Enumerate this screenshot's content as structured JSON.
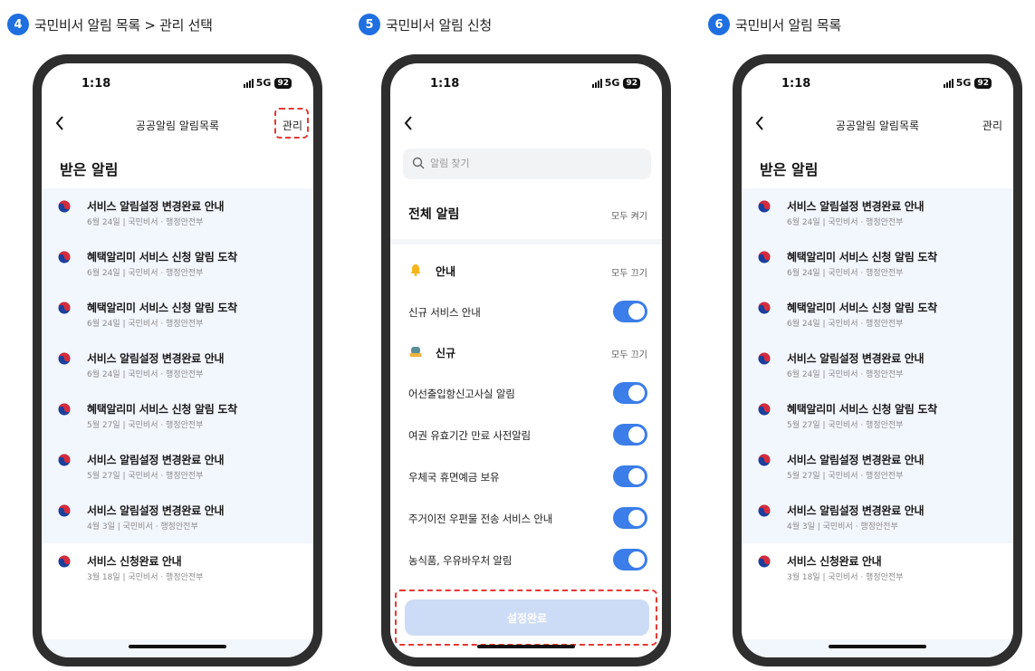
{
  "steps": [
    {
      "num": "4",
      "label": "국민비서 알림 목록 > 관리 선택"
    },
    {
      "num": "5",
      "label": "국민비서 알림 신청"
    },
    {
      "num": "6",
      "label": "국민비서 알림 목록"
    }
  ],
  "status": {
    "time": "1:18",
    "network": "5G",
    "battery": "92"
  },
  "list_screen": {
    "title": "공공알림 알림목록",
    "manage_label": "관리",
    "section_title": "받은 알림",
    "items": [
      {
        "title": "서비스 알림설정 변경완료 안내",
        "meta": "6월 24일 | 국민비서 · 행정안전부",
        "highlight": true
      },
      {
        "title": "혜택알리미 서비스 신청 알림 도착",
        "meta": "6월 24일 | 국민비서 · 행정안전부",
        "highlight": true
      },
      {
        "title": "혜택알리미 서비스 신청 알림 도착",
        "meta": "6월 24일 | 국민비서 · 행정안전부",
        "highlight": true
      },
      {
        "title": "서비스 알림설정 변경완료 안내",
        "meta": "6월 24일 | 국민비서 · 행정안전부",
        "highlight": true
      },
      {
        "title": "혜택알리미 서비스 신청 알림 도착",
        "meta": "5월 27일 | 국민비서 · 행정안전부",
        "highlight": true
      },
      {
        "title": "서비스 알림설정 변경완료 안내",
        "meta": "5월 27일 | 국민비서 · 행정안전부",
        "highlight": true
      },
      {
        "title": "서비스 알림설정 변경완료 안내",
        "meta": "4월 3일 | 국민비서 · 행정안전부",
        "highlight": true
      },
      {
        "title": "서비스 신청완료 안내",
        "meta": "3월 18일 | 국민비서 · 행정안전부",
        "highlight": false
      }
    ]
  },
  "settings_screen": {
    "search_placeholder": "알림 찾기",
    "all_title": "전체 알림",
    "all_action": "모두 켜기",
    "groups": [
      {
        "icon": "bell-icon",
        "title": "안내",
        "action": "모두 끄기",
        "rows": [
          {
            "label": "신규 서비스 안내",
            "on": true
          }
        ]
      },
      {
        "icon": "new-badge-icon",
        "title": "신규",
        "action": "모두 끄기",
        "rows": [
          {
            "label": "어선출입항신고사실 알림",
            "on": true
          },
          {
            "label": "여권 유효기간 만료 사전알림",
            "on": true
          },
          {
            "label": "우체국 휴면예금 보유",
            "on": true
          },
          {
            "label": "주거이전 우편물 전송 서비스 안내",
            "on": true
          },
          {
            "label": "농식품, 우유바우처 알림",
            "on": true
          }
        ]
      }
    ],
    "done_label": "설정완료"
  },
  "colors": {
    "accent": "#1f6fe0",
    "toggle_on": "#3b7de9",
    "highlight_bg": "#f2f6fd",
    "dashed_red": "#e53935"
  }
}
